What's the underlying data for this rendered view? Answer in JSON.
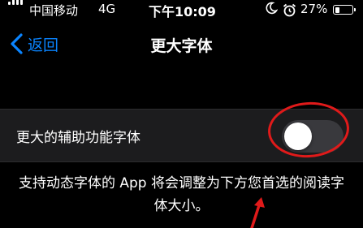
{
  "status_bar": {
    "carrier": "中国移动",
    "network": "4G",
    "time": "下午10:09",
    "battery_percent": "27%",
    "battery_level": 0.27,
    "icons": [
      "signal-icon",
      "moon-icon",
      "location-icon",
      "alarm-icon",
      "battery-icon"
    ]
  },
  "nav": {
    "back_label": "返回",
    "title": "更大字体"
  },
  "settings": {
    "larger_accessibility_label": "更大的辅助功能字体",
    "larger_accessibility_on": false
  },
  "footer": {
    "text": "支持动态字体的 App 将会调整为下方您首选的阅读字体大小。"
  },
  "colors": {
    "background": "#000000",
    "cell_background": "#1c1c1e",
    "accent": "#0a84ff",
    "toggle_off": "#39393d",
    "annotation": "#e01a1a"
  }
}
